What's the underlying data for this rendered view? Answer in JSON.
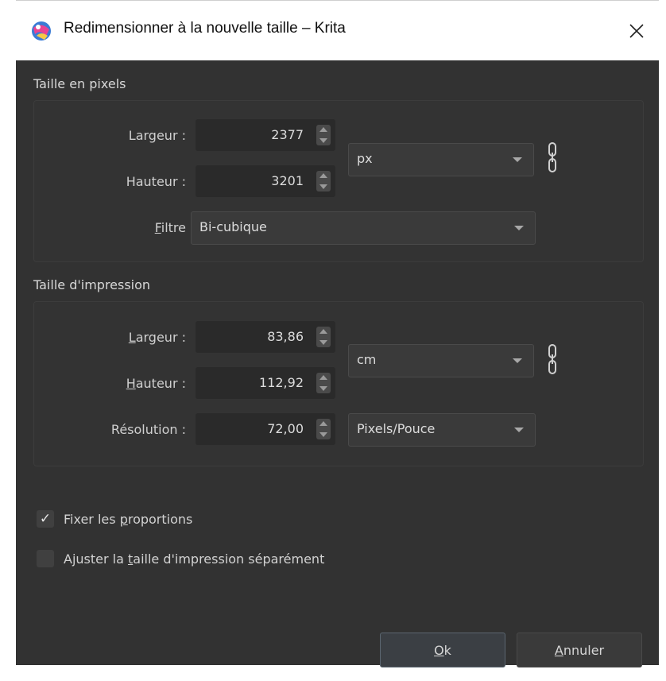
{
  "window": {
    "title": "Redimensionner à la nouvelle taille – Krita",
    "app_icon": "krita-icon",
    "close_icon": "close-icon"
  },
  "pixel_size": {
    "section_title": "Taille en pixels",
    "width_label": "Largeur :",
    "width_value": "2377",
    "height_label": "Hauteur :",
    "height_value": "3201",
    "unit": "px",
    "filter_label_prefix": "F",
    "filter_label_rest": "iltre",
    "filter_value": "Bi-cubique",
    "link_icon": "chain-link-icon"
  },
  "print_size": {
    "section_title": "Taille d'impression",
    "width_label_u": "L",
    "width_label_rest": "argeur :",
    "width_value": "83,86",
    "height_label_u": "H",
    "height_label_rest": "auteur :",
    "height_value": "112,92",
    "unit": "cm",
    "resolution_label": "Résolution :",
    "resolution_value": "72,00",
    "resolution_unit": "Pixels/Pouce",
    "link_icon": "chain-link-icon"
  },
  "options": {
    "keep_ratio_pre": "Fixer les ",
    "keep_ratio_u": "p",
    "keep_ratio_post": "roportions",
    "keep_ratio_checked": true,
    "keep_ratio_mark": "✓",
    "separate_pre": "Ajuster la ",
    "separate_u": "t",
    "separate_post": "aille d'impression séparément",
    "separate_checked": false
  },
  "buttons": {
    "ok_u": "O",
    "ok_rest": "k",
    "cancel_u": "A",
    "cancel_rest": "nnuler"
  }
}
